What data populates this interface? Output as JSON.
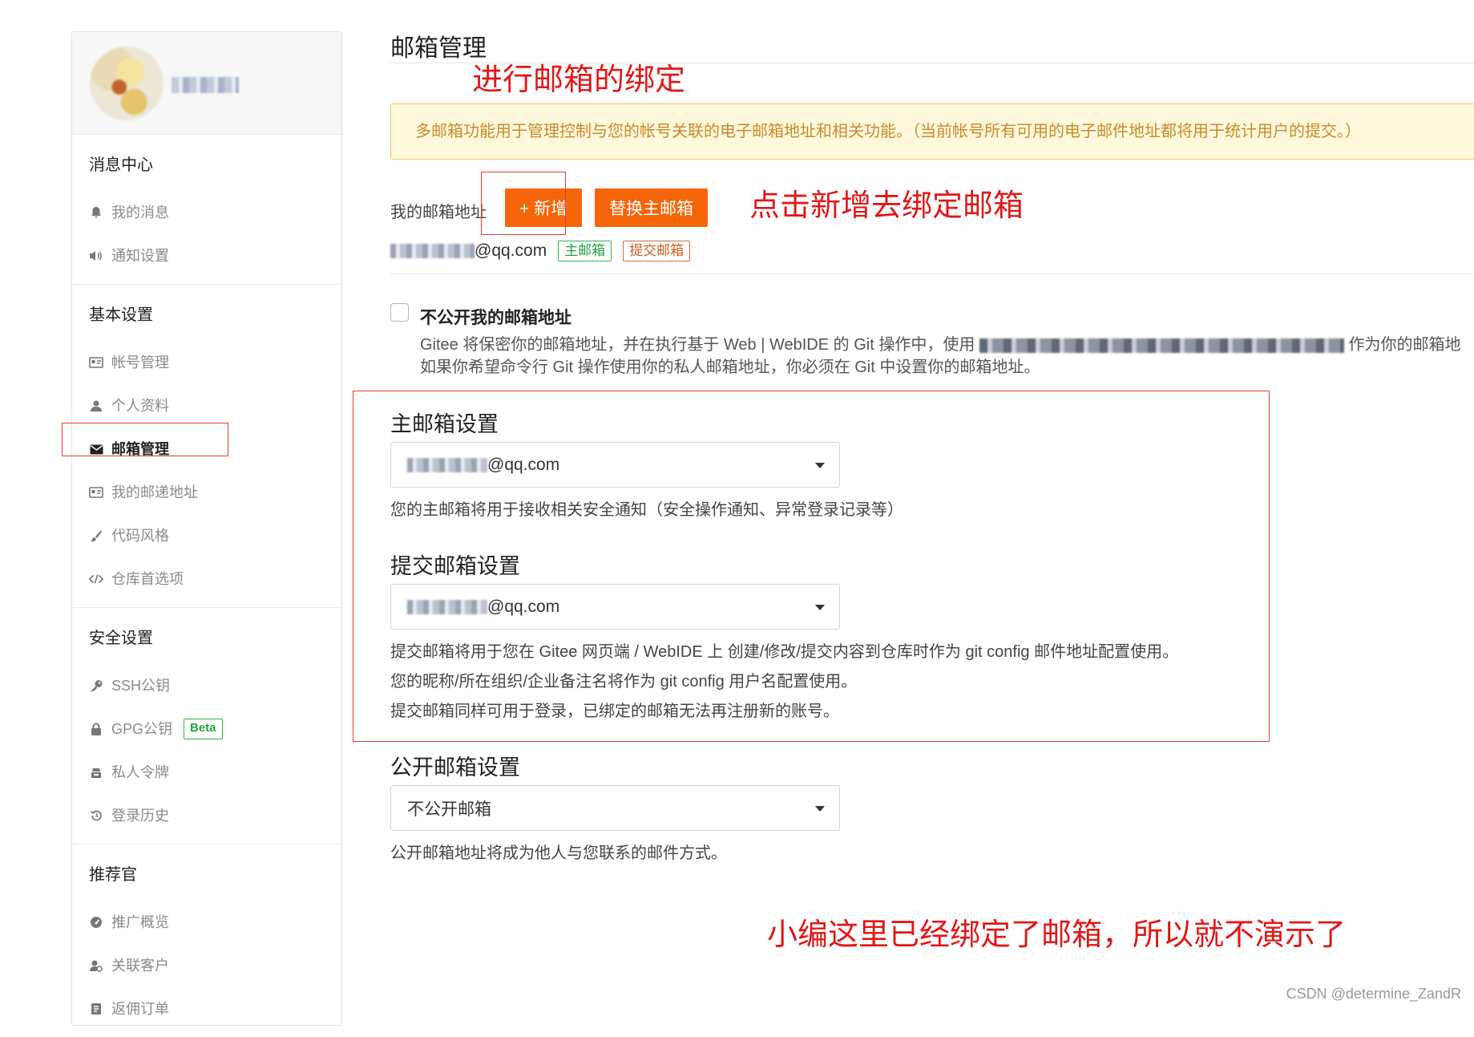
{
  "sidebar": {
    "groups": [
      {
        "title": "消息中心",
        "items": [
          {
            "label": "我的消息",
            "icon": "bell-icon"
          },
          {
            "label": "通知设置",
            "icon": "speaker-icon"
          }
        ]
      },
      {
        "title": "基本设置",
        "items": [
          {
            "label": "帐号管理",
            "icon": "id-card-icon"
          },
          {
            "label": "个人资料",
            "icon": "user-icon"
          },
          {
            "label": "邮箱管理",
            "icon": "envelope-icon",
            "active": true
          },
          {
            "label": "我的邮递地址",
            "icon": "id-card-icon"
          },
          {
            "label": "代码风格",
            "icon": "brush-icon"
          },
          {
            "label": "仓库首选项",
            "icon": "code-icon"
          }
        ]
      },
      {
        "title": "安全设置",
        "items": [
          {
            "label": "SSH公钥",
            "icon": "key-icon"
          },
          {
            "label": "GPG公钥",
            "icon": "lock-icon",
            "badge": "Beta"
          },
          {
            "label": "私人令牌",
            "icon": "token-icon"
          },
          {
            "label": "登录历史",
            "icon": "history-icon"
          }
        ]
      },
      {
        "title": "推荐官",
        "items": [
          {
            "label": "推广概览",
            "icon": "dashboard-icon"
          },
          {
            "label": "关联客户",
            "icon": "user-link-icon"
          },
          {
            "label": "返佣订单",
            "icon": "order-icon"
          }
        ]
      }
    ]
  },
  "main": {
    "title": "邮箱管理",
    "notice": "多邮箱功能用于管理控制与您的帐号关联的电子邮箱地址和相关功能。（当前帐号所有可用的电子邮件地址都将用于统计用户的提交。）",
    "my_email_label": "我的邮箱地址",
    "add_button": "+ 新增",
    "replace_button": "替换主邮箱",
    "email_suffix": "@qq.com",
    "tag_primary": "主邮箱",
    "tag_commit": "提交邮箱",
    "private_checkbox_label": "不公开我的邮箱地址",
    "private_desc_line1_a": "Gitee 将保密你的邮箱地址，并在执行基于 Web | WebIDE 的 Git 操作中，使用",
    "private_desc_line1_b": "作为你的邮箱地",
    "private_desc_line2": "如果你希望命令行 Git 操作使用你的私人邮箱地址，你必须在 Git 中设置你的邮箱地址。",
    "primary_title": "主邮箱设置",
    "primary_select": "@qq.com",
    "primary_help": "您的主邮箱将用于接收相关安全通知（安全操作通知、异常登录记录等）",
    "commit_title": "提交邮箱设置",
    "commit_select": "@qq.com",
    "commit_help_1": "提交邮箱将用于您在 Gitee 网页端 / WebIDE 上 创建/修改/提交内容到仓库时作为 git config 邮件地址配置使用。",
    "commit_help_2": "您的昵称/所在组织/企业备注名将作为 git config 用户名配置使用。",
    "commit_help_3": "提交邮箱同样可用于登录，已绑定的邮箱无法再注册新的账号。",
    "public_title": "公开邮箱设置",
    "public_select": "不公开邮箱",
    "public_help": "公开邮箱地址将成为他人与您联系的邮件方式。"
  },
  "annotations": {
    "bind": "进行邮箱的绑定",
    "click_add": "点击新增去绑定邮箱",
    "already": "小编这里已经绑定了邮箱，所以就不演示了"
  },
  "watermark": "CSDN @determine_ZandR",
  "colors": {
    "accent_orange": "#f5650a",
    "annotation_red": "#e01818",
    "notice_bg": "#fff8dc",
    "notice_text": "#c78a2c",
    "tag_green": "#22a03f"
  }
}
